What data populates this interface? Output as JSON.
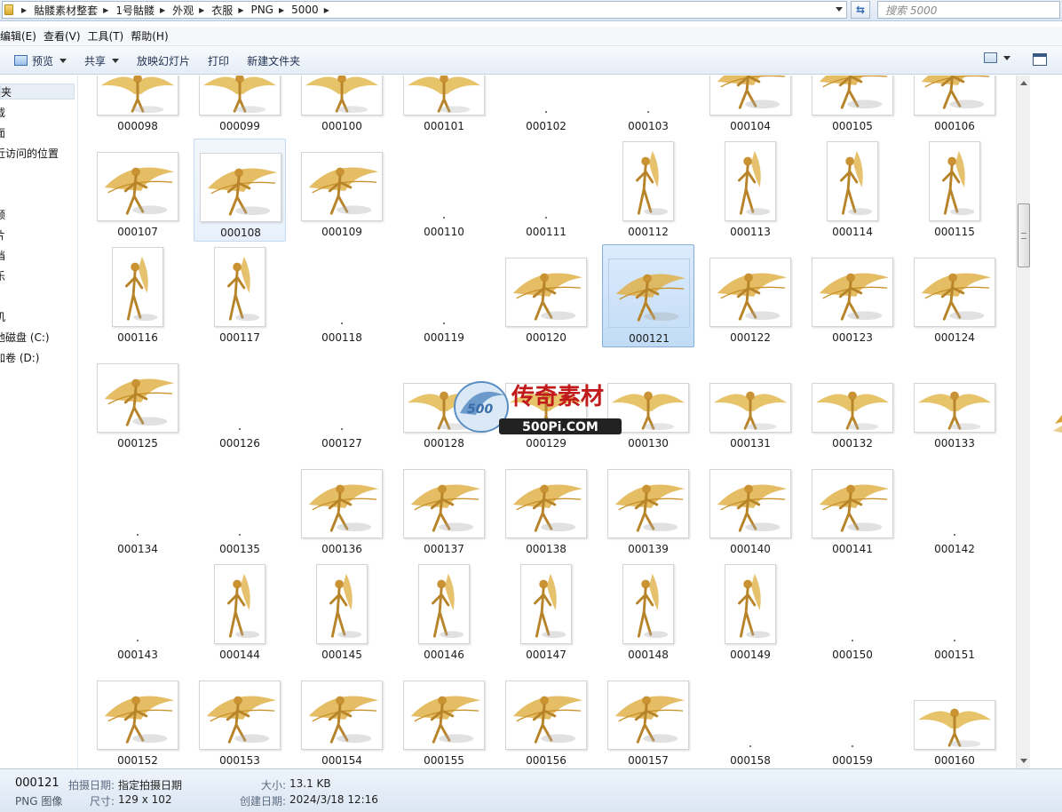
{
  "address_bar": {
    "crumbs": [
      "骷髅素材整套",
      "1号骷髅",
      "外观",
      "衣服",
      "PNG",
      "5000"
    ],
    "search_placeholder": "搜索 5000"
  },
  "menu": {
    "items": [
      "编辑(E)",
      "查看(V)",
      "工具(T)",
      "帮助(H)"
    ]
  },
  "toolbar": {
    "preview_label": "预览",
    "share_label": "共享",
    "slideshow_label": "放映幻灯片",
    "print_label": "打印",
    "new_folder_label": "新建文件夹"
  },
  "nav_pane": {
    "items": [
      "夹",
      "载",
      "面",
      "近访问的位置",
      "频",
      "片",
      "档",
      "乐",
      "机",
      "地磁盘 (C:)",
      "加卷 (D:)"
    ]
  },
  "files": {
    "names": [
      "000098",
      "000099",
      "000100",
      "000101",
      "000102",
      "000103",
      "000104",
      "000105",
      "000106",
      "000107",
      "000108",
      "000109",
      "000110",
      "000111",
      "000112",
      "000113",
      "000114",
      "000115",
      "000116",
      "000117",
      "000118",
      "000119",
      "000120",
      "000121",
      "000122",
      "000123",
      "000124",
      "000125",
      "000126",
      "000127",
      "000128",
      "000129",
      "000130",
      "000131",
      "000132",
      "000133",
      "000134",
      "000135",
      "000136",
      "000137",
      "000138",
      "000139",
      "000140",
      "000141",
      "000142",
      "000143",
      "000144",
      "000145",
      "000146",
      "000147",
      "000148",
      "000149",
      "000150",
      "000151",
      "000152",
      "000153",
      "000154",
      "000155",
      "000156",
      "000157",
      "000158",
      "000159",
      "000160"
    ],
    "selected": "000121",
    "hovered": "000108"
  },
  "watermark": {
    "brand_text": "传奇素材",
    "site_text": "500Pi.COM"
  },
  "details": {
    "file_name": "000121",
    "file_type": "PNG 图像",
    "date_taken_label": "拍摄日期:",
    "date_taken_value": "指定拍摄日期",
    "dimensions_label": "尺寸:",
    "dimensions_value": "129 x 102",
    "size_label": "大小:",
    "size_value": "13.1 KB",
    "created_label": "创建日期:",
    "created_value": "2024/3/18 12:16"
  },
  "colors": {
    "selection": "#c2dcf6",
    "gold": "#d9a636",
    "toolbar_text": "#1e3050"
  }
}
